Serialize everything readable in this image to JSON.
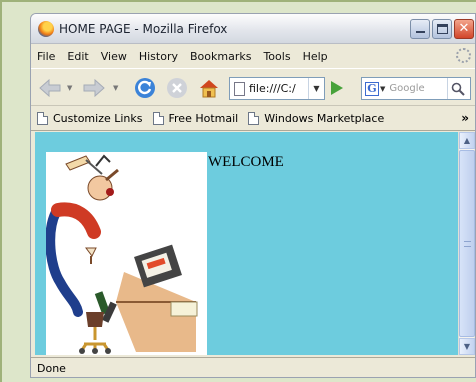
{
  "window": {
    "title": "HOME PAGE - Mozilla Firefox"
  },
  "menu": [
    {
      "label": "File"
    },
    {
      "label": "Edit"
    },
    {
      "label": "View"
    },
    {
      "label": "History"
    },
    {
      "label": "Bookmarks"
    },
    {
      "label": "Tools"
    },
    {
      "label": "Help"
    }
  ],
  "toolbar": {
    "url": "file:///C:/",
    "search_placeholder": "Google",
    "search_engine_letter": "G"
  },
  "bookmarks": [
    {
      "label": "Customize Links"
    },
    {
      "label": "Free Hotmail"
    },
    {
      "label": "Windows Marketplace"
    }
  ],
  "bookmarks_overflow": "»",
  "page": {
    "heading": "WELCOME"
  },
  "status": {
    "text": "Done"
  },
  "colors": {
    "page_background": "#6dccde",
    "chrome": "#ece9d8"
  }
}
